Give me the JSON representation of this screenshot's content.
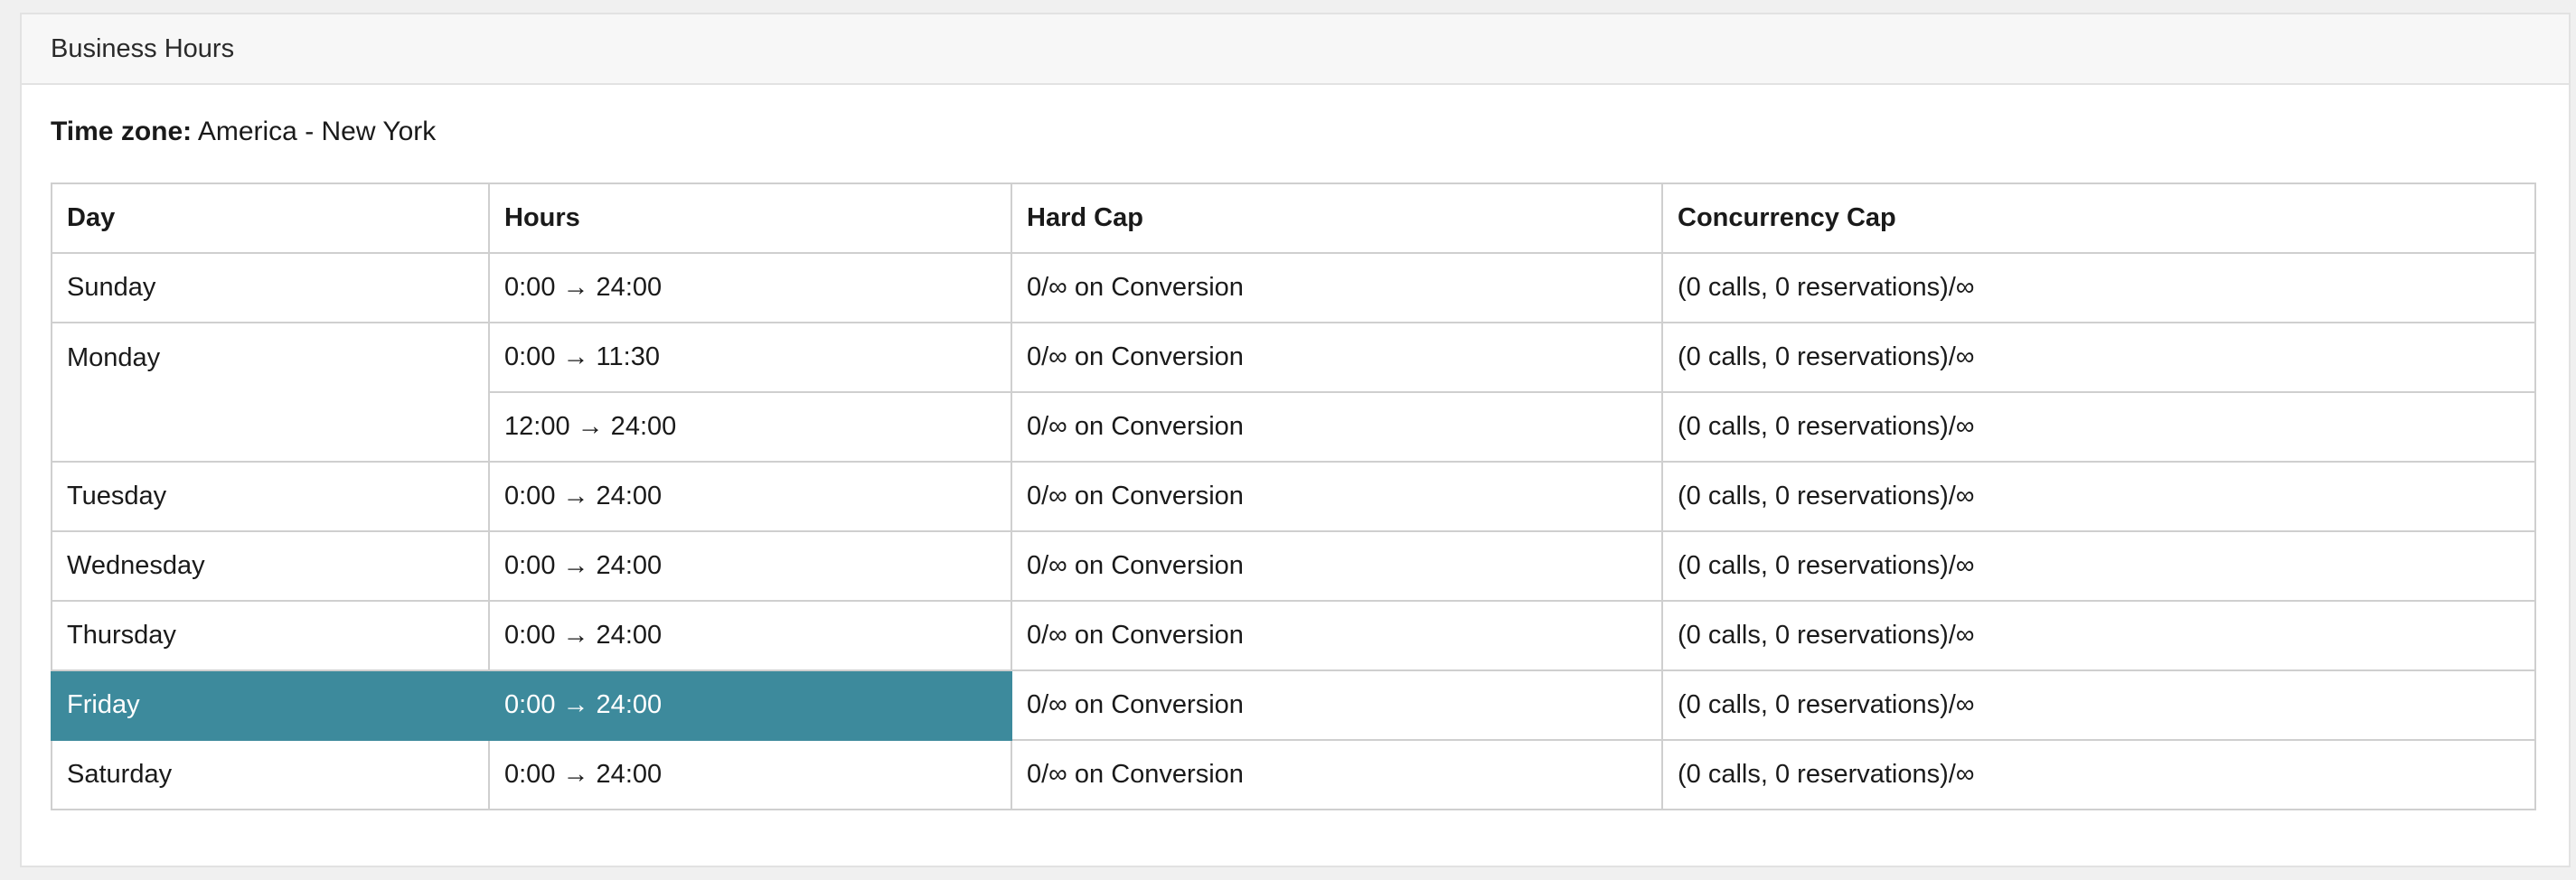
{
  "panel": {
    "title": "Business Hours"
  },
  "timezone": {
    "label": "Time zone:",
    "value": "America - New York"
  },
  "table": {
    "headers": {
      "day": "Day",
      "hours": "Hours",
      "hard_cap": "Hard Cap",
      "concurrency_cap": "Concurrency Cap"
    },
    "rows": [
      {
        "day": "Sunday",
        "slots": [
          {
            "hours": "0:00 → 24:00",
            "hard_cap": "0/∞ on Conversion",
            "concurrency_cap": "(0 calls, 0 reservations)/∞"
          }
        ]
      },
      {
        "day": "Monday",
        "slots": [
          {
            "hours": "0:00 → 11:30",
            "hard_cap": "0/∞ on Conversion",
            "concurrency_cap": "(0 calls, 0 reservations)/∞"
          },
          {
            "hours": "12:00 → 24:00",
            "hard_cap": "0/∞ on Conversion",
            "concurrency_cap": "(0 calls, 0 reservations)/∞"
          }
        ]
      },
      {
        "day": "Tuesday",
        "slots": [
          {
            "hours": "0:00 → 24:00",
            "hard_cap": "0/∞ on Conversion",
            "concurrency_cap": "(0 calls, 0 reservations)/∞"
          }
        ]
      },
      {
        "day": "Wednesday",
        "slots": [
          {
            "hours": "0:00 → 24:00",
            "hard_cap": "0/∞ on Conversion",
            "concurrency_cap": "(0 calls, 0 reservations)/∞"
          }
        ]
      },
      {
        "day": "Thursday",
        "slots": [
          {
            "hours": "0:00 → 24:00",
            "hard_cap": "0/∞ on Conversion",
            "concurrency_cap": "(0 calls, 0 reservations)/∞"
          }
        ]
      },
      {
        "day": "Friday",
        "slots": [
          {
            "hours": "0:00 → 24:00",
            "hard_cap": "0/∞ on Conversion",
            "concurrency_cap": "(0 calls, 0 reservations)/∞"
          }
        ]
      },
      {
        "day": "Saturday",
        "slots": [
          {
            "hours": "0:00 → 24:00",
            "hard_cap": "0/∞ on Conversion",
            "concurrency_cap": "(0 calls, 0 reservations)/∞"
          }
        ]
      }
    ]
  },
  "colors": {
    "highlight": "#3d8a9c",
    "header_bg": "#f7f7f7",
    "border": "#cfcfcf"
  }
}
